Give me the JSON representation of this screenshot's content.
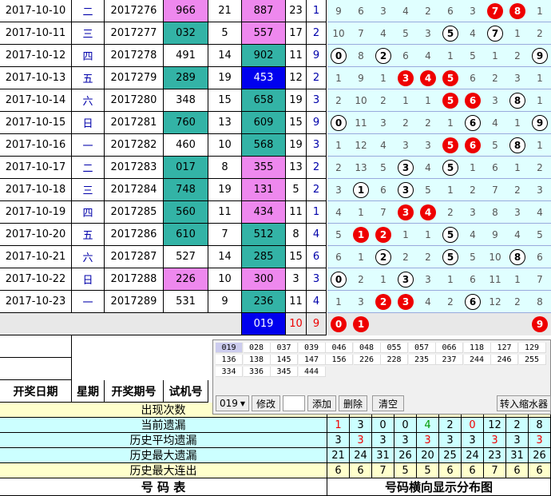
{
  "rows": [
    {
      "date": "2017-10-10",
      "weekday": "二",
      "issue": "2017276",
      "test": "966",
      "span": "21",
      "draw": "887",
      "sum": "23",
      "d": "1"
    },
    {
      "date": "2017-10-11",
      "weekday": "三",
      "issue": "2017277",
      "test": "032",
      "span": "5",
      "draw": "557",
      "sum": "17",
      "d": "2"
    },
    {
      "date": "2017-10-12",
      "weekday": "四",
      "issue": "2017278",
      "test": "491",
      "span": "14",
      "draw": "902",
      "sum": "11",
      "d": "9"
    },
    {
      "date": "2017-10-13",
      "weekday": "五",
      "issue": "2017279",
      "test": "289",
      "span": "19",
      "draw": "453",
      "sum": "12",
      "d": "2"
    },
    {
      "date": "2017-10-14",
      "weekday": "六",
      "issue": "2017280",
      "test": "348",
      "span": "15",
      "draw": "658",
      "sum": "19",
      "d": "3"
    },
    {
      "date": "2017-10-15",
      "weekday": "日",
      "issue": "2017281",
      "test": "760",
      "span": "13",
      "draw": "609",
      "sum": "15",
      "d": "9"
    },
    {
      "date": "2017-10-16",
      "weekday": "一",
      "issue": "2017282",
      "test": "460",
      "span": "10",
      "draw": "568",
      "sum": "19",
      "d": "3"
    },
    {
      "date": "2017-10-17",
      "weekday": "二",
      "issue": "2017283",
      "test": "017",
      "span": "8",
      "draw": "355",
      "sum": "13",
      "d": "2"
    },
    {
      "date": "2017-10-18",
      "weekday": "三",
      "issue": "2017284",
      "test": "748",
      "span": "19",
      "draw": "131",
      "sum": "5",
      "d": "2"
    },
    {
      "date": "2017-10-19",
      "weekday": "四",
      "issue": "2017285",
      "test": "560",
      "span": "11",
      "draw": "434",
      "sum": "11",
      "d": "1"
    },
    {
      "date": "2017-10-20",
      "weekday": "五",
      "issue": "2017286",
      "test": "610",
      "span": "7",
      "draw": "512",
      "sum": "8",
      "d": "4"
    },
    {
      "date": "2017-10-21",
      "weekday": "六",
      "issue": "2017287",
      "test": "527",
      "span": "14",
      "draw": "285",
      "sum": "15",
      "d": "6"
    },
    {
      "date": "2017-10-22",
      "weekday": "日",
      "issue": "2017288",
      "test": "226",
      "span": "10",
      "draw": "300",
      "sum": "3",
      "d": "3"
    },
    {
      "date": "2017-10-23",
      "weekday": "一",
      "issue": "2017289",
      "test": "531",
      "span": "9",
      "draw": "236",
      "sum": "11",
      "d": "4"
    }
  ],
  "dist": [
    [
      "9",
      "6",
      "3",
      "4",
      "2",
      "6",
      "3",
      "7",
      "8",
      "1"
    ],
    [
      "10",
      "7",
      "4",
      "5",
      "3",
      "5",
      "4",
      "7",
      "1",
      "2"
    ],
    [
      "0",
      "8",
      "2",
      "6",
      "4",
      "1",
      "5",
      "1",
      "2",
      "9"
    ],
    [
      "1",
      "9",
      "1",
      "3",
      "4",
      "5",
      "6",
      "2",
      "3",
      "1"
    ],
    [
      "2",
      "10",
      "2",
      "1",
      "1",
      "5",
      "6",
      "3",
      "8",
      "1"
    ],
    [
      "0",
      "11",
      "3",
      "2",
      "2",
      "1",
      "6",
      "4",
      "1",
      "9"
    ],
    [
      "1",
      "12",
      "4",
      "3",
      "3",
      "5",
      "6",
      "5",
      "8",
      "1"
    ],
    [
      "2",
      "13",
      "5",
      "3",
      "4",
      "5",
      "1",
      "6",
      "1",
      "2"
    ],
    [
      "3",
      "1",
      "6",
      "3",
      "5",
      "1",
      "2",
      "7",
      "2",
      "3"
    ],
    [
      "4",
      "1",
      "7",
      "3",
      "4",
      "2",
      "3",
      "8",
      "3",
      "4"
    ],
    [
      "5",
      "1",
      "2",
      "1",
      "1",
      "5",
      "4",
      "9",
      "4",
      "5"
    ],
    [
      "6",
      "1",
      "2",
      "2",
      "2",
      "5",
      "5",
      "10",
      "8",
      "6"
    ],
    [
      "0",
      "2",
      "1",
      "3",
      "3",
      "1",
      "6",
      "11",
      "1",
      "7"
    ],
    [
      "1",
      "3",
      "2",
      "3",
      "4",
      "2",
      "6",
      "12",
      "2",
      "8"
    ]
  ],
  "dist_red": [
    [
      7,
      8
    ],
    [],
    [],
    [
      3,
      4,
      5
    ],
    [
      5,
      6
    ],
    [],
    [
      5,
      6
    ],
    [],
    [],
    [
      3,
      4
    ],
    [
      1,
      2
    ],
    [],
    [],
    [
      2,
      3
    ]
  ],
  "dist_white": [
    [],
    [
      5,
      7
    ],
    [
      0,
      2,
      9
    ],
    [],
    [
      8
    ],
    [
      0,
      6,
      9
    ],
    [
      8
    ],
    [
      3,
      5
    ],
    [
      1,
      3
    ],
    [],
    [
      5
    ],
    [
      2,
      5,
      8
    ],
    [
      0,
      3
    ],
    [
      6
    ]
  ],
  "pred_row": {
    "draw": "019",
    "sum": "10",
    "d": "9",
    "red": [
      "0",
      "1"
    ],
    "red_pos": [
      0,
      1
    ],
    "white": [
      "9"
    ],
    "white_pos": [
      9
    ]
  },
  "headers": {
    "date": "开奖日期",
    "weekday": "星期",
    "issue": "开奖期号",
    "test": "试机号"
  },
  "stats": [
    {
      "label": "出现次数",
      "values": [
        "",
        "",
        "",
        "",
        "",
        "",
        "",
        "",
        "",
        ""
      ]
    },
    {
      "label": "当前遗漏",
      "values": [
        "1",
        "3",
        "0",
        "0",
        "4",
        "2",
        "0",
        "12",
        "2",
        "8"
      ]
    },
    {
      "label": "历史平均遗漏",
      "values": [
        "3",
        "3",
        "3",
        "3",
        "3",
        "3",
        "3",
        "3",
        "3",
        "3"
      ]
    },
    {
      "label": "历史最大遗漏",
      "values": [
        "21",
        "24",
        "31",
        "26",
        "20",
        "25",
        "24",
        "23",
        "31",
        "26"
      ]
    },
    {
      "label": "历史最大连出",
      "values": [
        "6",
        "6",
        "7",
        "5",
        "5",
        "6",
        "6",
        "7",
        "6",
        "6"
      ]
    }
  ],
  "footer": {
    "left": "号  码  表",
    "right": "号码横向显示分布图"
  },
  "panel": {
    "numbers": [
      "019",
      "028",
      "037",
      "039",
      "046",
      "048",
      "055",
      "057",
      "066",
      "118",
      "127",
      "129",
      "136",
      "138",
      "145",
      "147",
      "156",
      "226",
      "228",
      "235",
      "237",
      "244",
      "246",
      "255",
      "334",
      "336",
      "345",
      "444"
    ],
    "select_value": "019",
    "modify": "修改",
    "add": "添加",
    "delete": "删除",
    "clear": "清空",
    "transfer": "转入缩水器"
  },
  "colors": {
    "teal": "#33b3a6",
    "pink": "#ee88ee",
    "blue": "#0000ee",
    "cyan_bg": "#e0ffff",
    "red": "#ee0000",
    "yellow": "#ffffcc",
    "green_stat": "#ccffcc"
  }
}
